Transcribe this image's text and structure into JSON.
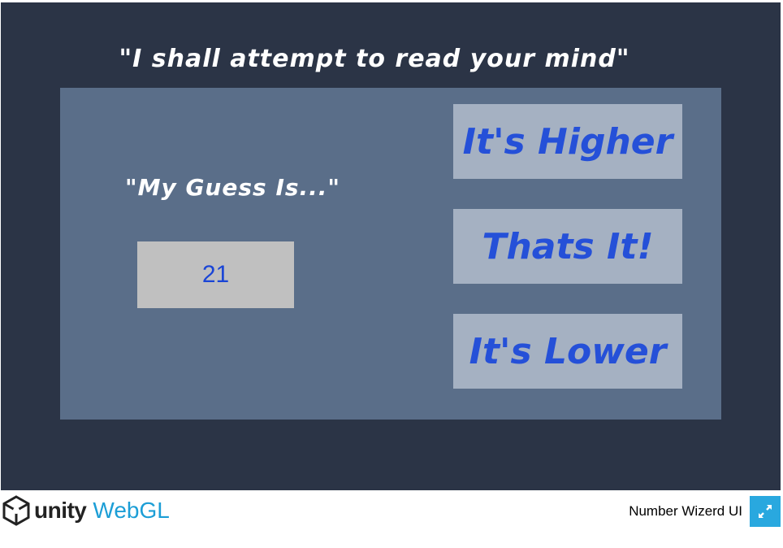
{
  "game": {
    "headline": "\"I shall attempt to read your mind\"",
    "guess_label": "\"My Guess Is...\"",
    "guess_value": "21",
    "buttons": {
      "higher": "It's Higher",
      "correct": "Thats It!",
      "lower": "It's Lower"
    }
  },
  "footer": {
    "brand": "unity",
    "platform": "WebGL",
    "title": "Number Wizerd UI",
    "fullscreen_icon": "fullscreen-expand-icon"
  },
  "colors": {
    "canvas_bg": "#2b3446",
    "panel_bg": "#5a6e89",
    "button_bg": "#a5b1c2",
    "button_text": "#2550d8",
    "guess_box_bg": "#c0c0c0",
    "guess_text": "#1a45d6",
    "webgl_accent": "#1c9ed6",
    "fullscreen_bg": "#29a8df"
  }
}
